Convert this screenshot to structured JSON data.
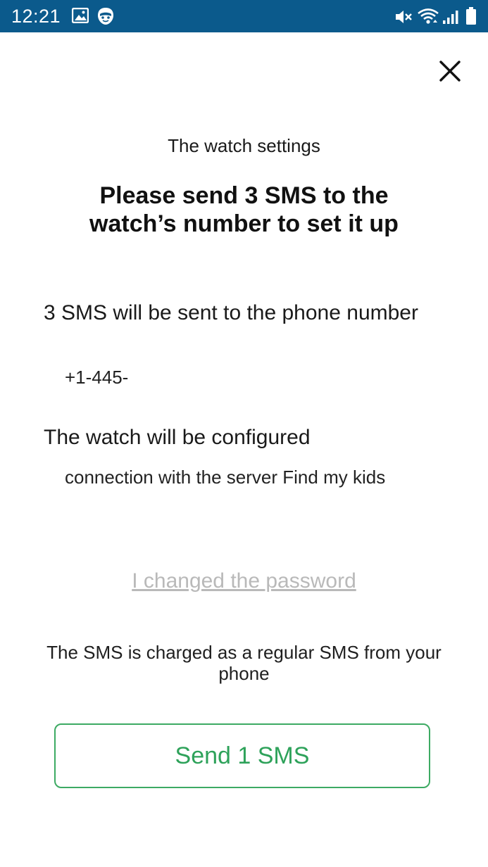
{
  "status_bar": {
    "time": "12:21",
    "icons_left": [
      "image-icon",
      "app-mascot-icon"
    ],
    "icons_right": [
      "mute-icon",
      "wifi-icon",
      "signal-icon",
      "battery-icon"
    ],
    "background_color": "#0b5a8c"
  },
  "header": {
    "close_icon": "close-icon"
  },
  "content": {
    "subtitle": "The watch settings",
    "heading_line1": "Please send 3 SMS to the",
    "heading_line2": "watch’s number to set it up",
    "sms_section": {
      "title": "3 SMS will be sent to the phone number",
      "phone_number": "+1-445-"
    },
    "config_section": {
      "title": "The watch will be configured",
      "value": "connection with the server Find my kids"
    },
    "changed_password_link": "I changed the password",
    "note": "The SMS is charged as a regular SMS from your phone"
  },
  "action": {
    "send_button_label": "Send 1 SMS",
    "accent_color": "#2ea25a"
  }
}
